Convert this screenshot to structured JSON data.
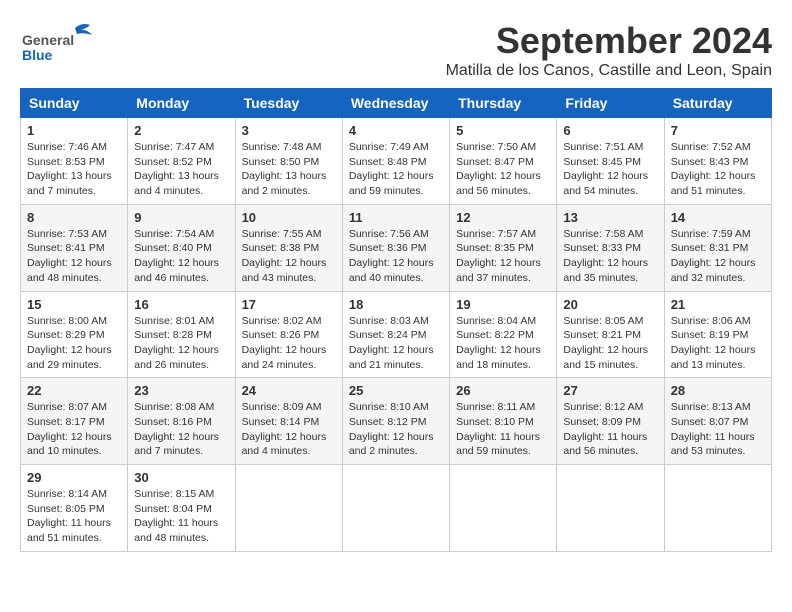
{
  "logo": {
    "line1": "General",
    "line2": "Blue"
  },
  "title": "September 2024",
  "subtitle": "Matilla de los Canos, Castille and Leon, Spain",
  "header": {
    "accent_color": "#1565c0"
  },
  "weekdays": [
    "Sunday",
    "Monday",
    "Tuesday",
    "Wednesday",
    "Thursday",
    "Friday",
    "Saturday"
  ],
  "weeks": [
    [
      {
        "day": "1",
        "sunrise": "Sunrise: 7:46 AM",
        "sunset": "Sunset: 8:53 PM",
        "daylight": "Daylight: 13 hours and 7 minutes."
      },
      {
        "day": "2",
        "sunrise": "Sunrise: 7:47 AM",
        "sunset": "Sunset: 8:52 PM",
        "daylight": "Daylight: 13 hours and 4 minutes."
      },
      {
        "day": "3",
        "sunrise": "Sunrise: 7:48 AM",
        "sunset": "Sunset: 8:50 PM",
        "daylight": "Daylight: 13 hours and 2 minutes."
      },
      {
        "day": "4",
        "sunrise": "Sunrise: 7:49 AM",
        "sunset": "Sunset: 8:48 PM",
        "daylight": "Daylight: 12 hours and 59 minutes."
      },
      {
        "day": "5",
        "sunrise": "Sunrise: 7:50 AM",
        "sunset": "Sunset: 8:47 PM",
        "daylight": "Daylight: 12 hours and 56 minutes."
      },
      {
        "day": "6",
        "sunrise": "Sunrise: 7:51 AM",
        "sunset": "Sunset: 8:45 PM",
        "daylight": "Daylight: 12 hours and 54 minutes."
      },
      {
        "day": "7",
        "sunrise": "Sunrise: 7:52 AM",
        "sunset": "Sunset: 8:43 PM",
        "daylight": "Daylight: 12 hours and 51 minutes."
      }
    ],
    [
      {
        "day": "8",
        "sunrise": "Sunrise: 7:53 AM",
        "sunset": "Sunset: 8:41 PM",
        "daylight": "Daylight: 12 hours and 48 minutes."
      },
      {
        "day": "9",
        "sunrise": "Sunrise: 7:54 AM",
        "sunset": "Sunset: 8:40 PM",
        "daylight": "Daylight: 12 hours and 46 minutes."
      },
      {
        "day": "10",
        "sunrise": "Sunrise: 7:55 AM",
        "sunset": "Sunset: 8:38 PM",
        "daylight": "Daylight: 12 hours and 43 minutes."
      },
      {
        "day": "11",
        "sunrise": "Sunrise: 7:56 AM",
        "sunset": "Sunset: 8:36 PM",
        "daylight": "Daylight: 12 hours and 40 minutes."
      },
      {
        "day": "12",
        "sunrise": "Sunrise: 7:57 AM",
        "sunset": "Sunset: 8:35 PM",
        "daylight": "Daylight: 12 hours and 37 minutes."
      },
      {
        "day": "13",
        "sunrise": "Sunrise: 7:58 AM",
        "sunset": "Sunset: 8:33 PM",
        "daylight": "Daylight: 12 hours and 35 minutes."
      },
      {
        "day": "14",
        "sunrise": "Sunrise: 7:59 AM",
        "sunset": "Sunset: 8:31 PM",
        "daylight": "Daylight: 12 hours and 32 minutes."
      }
    ],
    [
      {
        "day": "15",
        "sunrise": "Sunrise: 8:00 AM",
        "sunset": "Sunset: 8:29 PM",
        "daylight": "Daylight: 12 hours and 29 minutes."
      },
      {
        "day": "16",
        "sunrise": "Sunrise: 8:01 AM",
        "sunset": "Sunset: 8:28 PM",
        "daylight": "Daylight: 12 hours and 26 minutes."
      },
      {
        "day": "17",
        "sunrise": "Sunrise: 8:02 AM",
        "sunset": "Sunset: 8:26 PM",
        "daylight": "Daylight: 12 hours and 24 minutes."
      },
      {
        "day": "18",
        "sunrise": "Sunrise: 8:03 AM",
        "sunset": "Sunset: 8:24 PM",
        "daylight": "Daylight: 12 hours and 21 minutes."
      },
      {
        "day": "19",
        "sunrise": "Sunrise: 8:04 AM",
        "sunset": "Sunset: 8:22 PM",
        "daylight": "Daylight: 12 hours and 18 minutes."
      },
      {
        "day": "20",
        "sunrise": "Sunrise: 8:05 AM",
        "sunset": "Sunset: 8:21 PM",
        "daylight": "Daylight: 12 hours and 15 minutes."
      },
      {
        "day": "21",
        "sunrise": "Sunrise: 8:06 AM",
        "sunset": "Sunset: 8:19 PM",
        "daylight": "Daylight: 12 hours and 13 minutes."
      }
    ],
    [
      {
        "day": "22",
        "sunrise": "Sunrise: 8:07 AM",
        "sunset": "Sunset: 8:17 PM",
        "daylight": "Daylight: 12 hours and 10 minutes."
      },
      {
        "day": "23",
        "sunrise": "Sunrise: 8:08 AM",
        "sunset": "Sunset: 8:16 PM",
        "daylight": "Daylight: 12 hours and 7 minutes."
      },
      {
        "day": "24",
        "sunrise": "Sunrise: 8:09 AM",
        "sunset": "Sunset: 8:14 PM",
        "daylight": "Daylight: 12 hours and 4 minutes."
      },
      {
        "day": "25",
        "sunrise": "Sunrise: 8:10 AM",
        "sunset": "Sunset: 8:12 PM",
        "daylight": "Daylight: 12 hours and 2 minutes."
      },
      {
        "day": "26",
        "sunrise": "Sunrise: 8:11 AM",
        "sunset": "Sunset: 8:10 PM",
        "daylight": "Daylight: 11 hours and 59 minutes."
      },
      {
        "day": "27",
        "sunrise": "Sunrise: 8:12 AM",
        "sunset": "Sunset: 8:09 PM",
        "daylight": "Daylight: 11 hours and 56 minutes."
      },
      {
        "day": "28",
        "sunrise": "Sunrise: 8:13 AM",
        "sunset": "Sunset: 8:07 PM",
        "daylight": "Daylight: 11 hours and 53 minutes."
      }
    ],
    [
      {
        "day": "29",
        "sunrise": "Sunrise: 8:14 AM",
        "sunset": "Sunset: 8:05 PM",
        "daylight": "Daylight: 11 hours and 51 minutes."
      },
      {
        "day": "30",
        "sunrise": "Sunrise: 8:15 AM",
        "sunset": "Sunset: 8:04 PM",
        "daylight": "Daylight: 11 hours and 48 minutes."
      },
      null,
      null,
      null,
      null,
      null
    ]
  ]
}
